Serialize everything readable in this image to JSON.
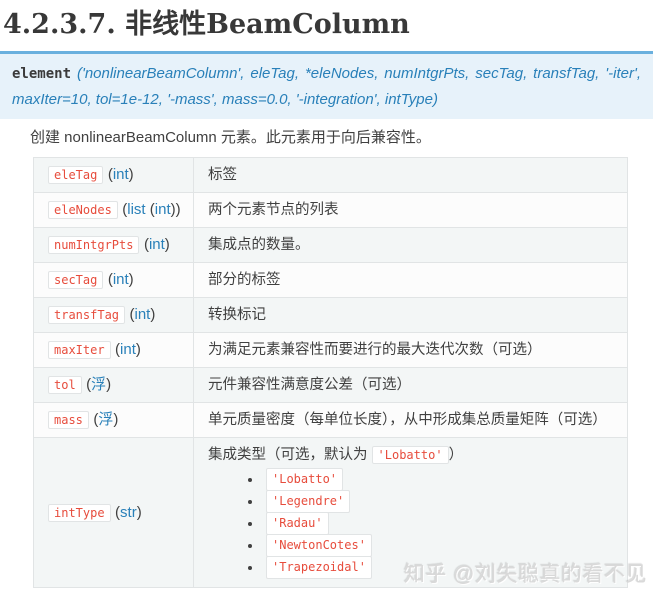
{
  "page_title": "4.2.3.7. 非线性BeamColumn",
  "signature": {
    "keyword": "element",
    "line1_args": "('nonlinearBeamColumn', eleTag, *eleNodes, numIntgrPts, secTag, transfTag, '-iter',",
    "line2_args": "maxIter=10, tol=1e-12, '-mass', mass=0.0, '-integration', intType)"
  },
  "description": "创建 nonlinearBeamColumn 元素。此元素用于向后兼容性。",
  "colors": {
    "accent_border": "#6ab0de",
    "signature_bg": "#e7f2fa",
    "link_blue": "#2980b9",
    "code_red": "#e74c3c",
    "table_border": "#e1e4e5",
    "row_shaded": "#f3f6f6",
    "body_text": "#404040"
  },
  "table": {
    "rows": [
      {
        "param": "eleTag",
        "type": [
          {
            "text": "(",
            "link": false
          },
          {
            "text": "int",
            "link": true
          },
          {
            "text": ")",
            "link": false
          }
        ],
        "desc": "标签"
      },
      {
        "param": "eleNodes",
        "type": [
          {
            "text": "(",
            "link": false
          },
          {
            "text": "list",
            "link": true
          },
          {
            "text": " (",
            "link": false
          },
          {
            "text": "int",
            "link": true
          },
          {
            "text": "))",
            "link": false
          }
        ],
        "desc": "两个元素节点的列表"
      },
      {
        "param": "numIntgrPts",
        "type": [
          {
            "text": "(",
            "link": false
          },
          {
            "text": "int",
            "link": true
          },
          {
            "text": ")",
            "link": false
          }
        ],
        "desc": "集成点的数量。"
      },
      {
        "param": "secTag",
        "type": [
          {
            "text": "(",
            "link": false
          },
          {
            "text": "int",
            "link": true
          },
          {
            "text": ")",
            "link": false
          }
        ],
        "desc": "部分的标签"
      },
      {
        "param": "transfTag",
        "type": [
          {
            "text": "(",
            "link": false
          },
          {
            "text": "int",
            "link": true
          },
          {
            "text": ")",
            "link": false
          }
        ],
        "desc": "转换标记"
      },
      {
        "param": "maxIter",
        "type": [
          {
            "text": "(",
            "link": false
          },
          {
            "text": "int",
            "link": true
          },
          {
            "text": ")",
            "link": false
          }
        ],
        "desc": "为满足元素兼容性而要进行的最大迭代次数（可选）"
      },
      {
        "param": "tol",
        "type": [
          {
            "text": "(",
            "link": false
          },
          {
            "text": "浮",
            "link": true
          },
          {
            "text": ")",
            "link": false
          }
        ],
        "desc": "元件兼容性满意度公差（可选）"
      },
      {
        "param": "mass",
        "type": [
          {
            "text": "(",
            "link": false
          },
          {
            "text": "浮",
            "link": true
          },
          {
            "text": ")",
            "link": false
          }
        ],
        "desc": "单元质量密度（每单位长度），从中形成集总质量矩阵（可选）"
      },
      {
        "param": "intType",
        "type": [
          {
            "text": "(",
            "link": false
          },
          {
            "text": "str",
            "link": true
          },
          {
            "text": ")",
            "link": false
          }
        ],
        "desc_intro": {
          "prefix": "集成类型（可选，默认为 ",
          "code": "'Lobatto'",
          "suffix": "）"
        },
        "options": [
          "'Lobatto'",
          "'Legendre'",
          "'Radau'",
          "'NewtonCotes'",
          "'Trapezoidal'"
        ]
      }
    ]
  },
  "watermark": "知乎 @刘失聪真的看不见"
}
